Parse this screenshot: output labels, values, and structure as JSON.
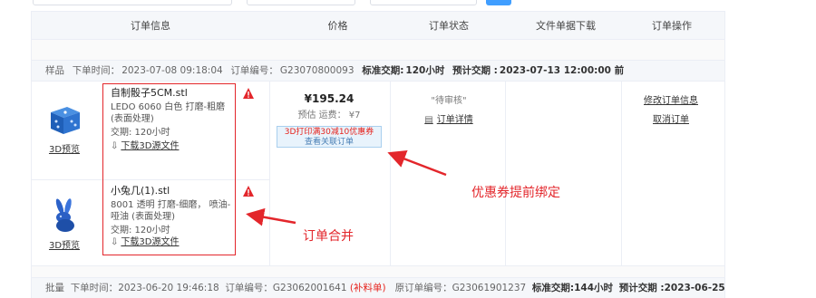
{
  "header": {
    "col_order_info": "订单信息",
    "col_price": "价格",
    "col_status": "订单状态",
    "col_download": "文件单据下载",
    "col_ops": "订单操作"
  },
  "order1": {
    "meta": {
      "type": "样品",
      "time_label": "下单时间：",
      "time": "2023-07-08 09:18:04",
      "no_label": "订单编号：",
      "no": "G23070800093",
      "lead_label": "标准交期:",
      "lead": "120小时",
      "eta_label": "预计交期 :",
      "eta": "2023-07-13 12:00:00 前"
    },
    "items": [
      {
        "filename": "自制骰子5CM.stl",
        "spec": "LEDO 6060  白色  打磨-粗磨 (表面处理)",
        "lead": "交期: 120小时",
        "download": "下载3D源文件",
        "preview": "3D预览"
      },
      {
        "filename": "小兔几(1).stl",
        "spec": "8001  透明  打磨-细磨， 喷油-哑油 (表面处理)",
        "lead": "交期: 120小时",
        "download": "下载3D源文件",
        "preview": "3D预览"
      }
    ],
    "price": {
      "amount": "¥195.24",
      "shipping": "预估 运费：  ¥7",
      "coupon_line1": "3D打印满30减10优惠券",
      "coupon_line2": "查看关联订单"
    },
    "status": {
      "state": "\"待审核\"",
      "detail": "订单详情"
    },
    "ops": {
      "modify": "修改订单信息",
      "cancel": "取消订单"
    }
  },
  "annotations": {
    "coupon": "优惠券提前绑定",
    "merge": "订单合并"
  },
  "order2": {
    "meta": {
      "type": "批量",
      "time_label": "下单时间：",
      "time": "2023-06-20 19:46:18",
      "no_label": "订单编号：",
      "no": "G23062001641",
      "tag": "(补料单)",
      "orig_label": "原订单编号：",
      "orig": "G23061901237",
      "lead_label": "标准交期:",
      "lead": "144小时",
      "eta_label": "预计交期 :",
      "eta": "2023-06-25 2"
    }
  },
  "colors": {
    "accent_red": "#e3262b",
    "link_blue": "#409eff",
    "header_bg": "#f5f7fa"
  }
}
